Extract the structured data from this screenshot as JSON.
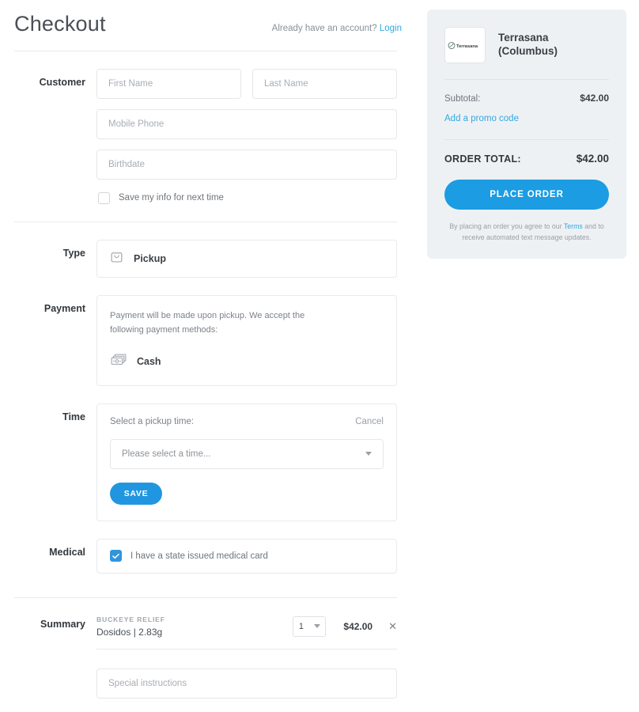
{
  "header": {
    "title": "Checkout",
    "account_prompt": "Already have an account?",
    "login_label": "Login"
  },
  "sections": {
    "customer": {
      "label": "Customer",
      "first_name_placeholder": "First Name",
      "last_name_placeholder": "Last Name",
      "mobile_placeholder": "Mobile Phone",
      "birthdate_placeholder": "Birthdate",
      "save_info_label": "Save my info for next time",
      "save_info_checked": false
    },
    "type": {
      "label": "Type",
      "selected": "Pickup",
      "icon": "shopping-bag-icon"
    },
    "payment": {
      "label": "Payment",
      "description": "Payment will be made upon pickup. We accept the following payment methods:",
      "method": "Cash",
      "method_icon": "cash-bills-icon"
    },
    "time": {
      "label": "Time",
      "prompt": "Select a pickup time:",
      "cancel_label": "Cancel",
      "select_placeholder": "Please select a time...",
      "save_label": "SAVE"
    },
    "medical": {
      "label": "Medical",
      "checkbox_label": "I have a state issued medical card",
      "checked": true
    },
    "summary": {
      "label": "Summary",
      "items": [
        {
          "brand": "BUCKEYE RELIEF",
          "name": "Dosidos | 2.83g",
          "quantity": "1",
          "price": "$42.00",
          "remove_icon": "close-icon"
        }
      ],
      "special_instructions_placeholder": "Special instructions"
    }
  },
  "order_summary": {
    "store_name": "Terrasana (Columbus)",
    "logo_text": "Terrasana",
    "subtotal_label": "Subtotal:",
    "subtotal_value": "$42.00",
    "promo_label": "Add a promo code",
    "total_label": "ORDER TOTAL:",
    "total_value": "$42.00",
    "place_order_label": "PLACE ORDER",
    "disclaimer_prefix": "By placing an order you agree to our ",
    "disclaimer_link": "Terms",
    "disclaimer_suffix": " and to receive automated text message updates."
  },
  "colors": {
    "accent": "#1b9ce3",
    "link": "#31a8e0",
    "sidebar_bg": "#eef1f4"
  }
}
